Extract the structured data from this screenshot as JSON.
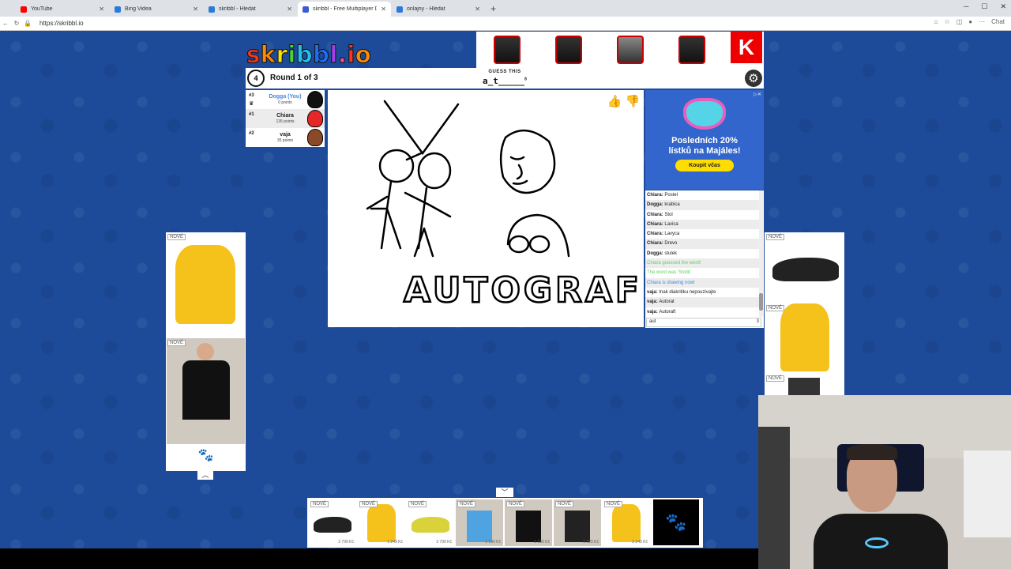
{
  "browser": {
    "tabs": [
      {
        "title": "YouTube",
        "color": "#ff0000"
      },
      {
        "title": "Bing Videa",
        "color": "#2b7bd6"
      },
      {
        "title": "skribbl - Hledat",
        "color": "#2b7bd6"
      },
      {
        "title": "skribbl - Free Multiplayer Dra",
        "color": "#3a5bd4",
        "active": true
      },
      {
        "title": "onlajny - Hledat",
        "color": "#2b7bd6"
      }
    ],
    "url": "https://skribbl.io",
    "chat_label": "Chat"
  },
  "game": {
    "logo": "skribbl.io",
    "timer": "4",
    "round": "Round 1 of 3",
    "guess_label": "GUESS THIS",
    "word": "a_t_____",
    "word_len": "8",
    "canvas_text": "AUTOGRAF"
  },
  "players": [
    {
      "rank": "#3",
      "name": "Dogga (You)",
      "points": "0 points",
      "avatar_color": "#111111",
      "is_you": true
    },
    {
      "rank": "#1",
      "name": "Chiara",
      "points": "135 points",
      "avatar_color": "#e52727"
    },
    {
      "rank": "#2",
      "name": "vaja",
      "points": "35 points",
      "avatar_color": "#8a4a2a"
    }
  ],
  "chat": {
    "messages": [
      {
        "user": "Chiara",
        "text": "Postel"
      },
      {
        "user": "Dogga",
        "text": "krabica"
      },
      {
        "user": "Chiara",
        "text": "Stol"
      },
      {
        "user": "Chiara",
        "text": "Lavica"
      },
      {
        "user": "Chiara",
        "text": "Lavyca"
      },
      {
        "user": "Chiara",
        "text": "Drevo"
      },
      {
        "user": "Dogga",
        "text": "stulek"
      },
      {
        "system": "Chiara guessed the word!",
        "color": "green"
      },
      {
        "system": "The word was 'Stolik'",
        "color": "green"
      },
      {
        "system": "Chiara is drawing now!",
        "color": "blue"
      },
      {
        "user": "vaja",
        "text": "Inak diakritiku nepouzivajte"
      },
      {
        "user": "vaja",
        "text": "Autorat"
      },
      {
        "user": "vaja",
        "text": "Autoraft"
      }
    ],
    "input_value": "aut",
    "char_count": "3"
  },
  "ads": {
    "right_banner": {
      "line1": "Posledních 20%",
      "line2": "lístků na Majáles!",
      "button": "Koupit včas"
    },
    "nove": "NOVÉ",
    "prices": [
      "3 799 Kč",
      "1 249 Kč",
      "3 799 Kč",
      "1 199 Kč",
      "1 199 Kč",
      "1 329 Kč",
      "2 149 Kč"
    ]
  }
}
